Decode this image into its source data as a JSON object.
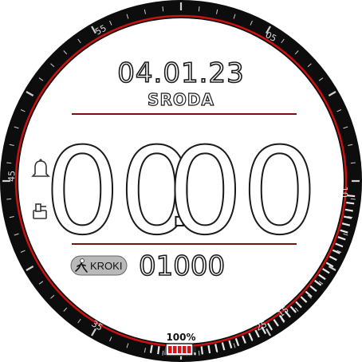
{
  "date": "04.01.23",
  "weekday": "SRODA",
  "time": {
    "hours": "00",
    "separator": ":",
    "minutes": "00"
  },
  "steps": {
    "label": "KROKI",
    "value": "01000",
    "goal_progress": 0.1,
    "icon": "walking-person-icon"
  },
  "battery": {
    "percent_label": "100%",
    "level": 1.0,
    "icon": "battery-icon"
  },
  "left_icons": [
    "bell-icon",
    "alarm-icon"
  ],
  "bezel_numbers": [
    "55",
    "05",
    "10",
    "15",
    "25",
    "35",
    "45"
  ],
  "colors": {
    "accent": "#cc1111",
    "bezel": "#111111",
    "background": "#ffffff",
    "battery_fill": "#dd1111"
  }
}
